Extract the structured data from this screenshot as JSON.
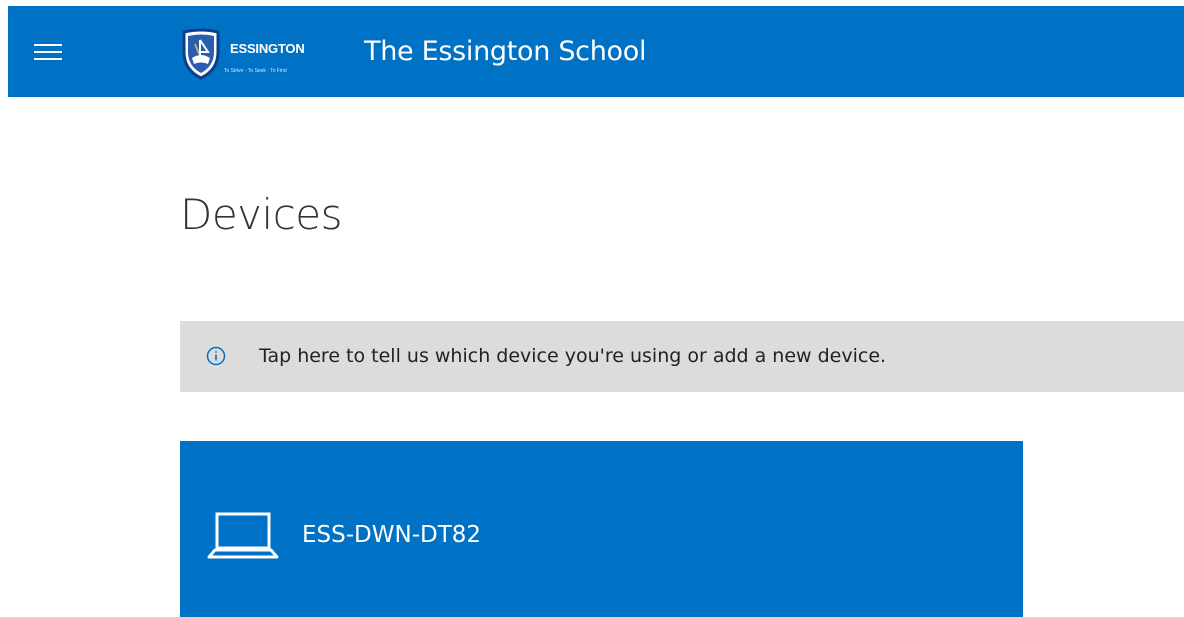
{
  "header": {
    "logo_wordmark": "ESSINGTON",
    "logo_motto": "To Strive · To Seek · To Find",
    "school_name": "The Essington School",
    "background_color": "#0072c6"
  },
  "main": {
    "title": "Devices",
    "info_banner": {
      "icon": "info-icon",
      "text": "Tap here to tell us which device you're using or add a new device."
    },
    "devices": [
      {
        "icon": "laptop-icon",
        "name": "ESS-DWN-DT82"
      }
    ]
  },
  "colors": {
    "accent": "#0072c6",
    "banner_bg": "#dcdcdc",
    "title_text": "#333333"
  }
}
